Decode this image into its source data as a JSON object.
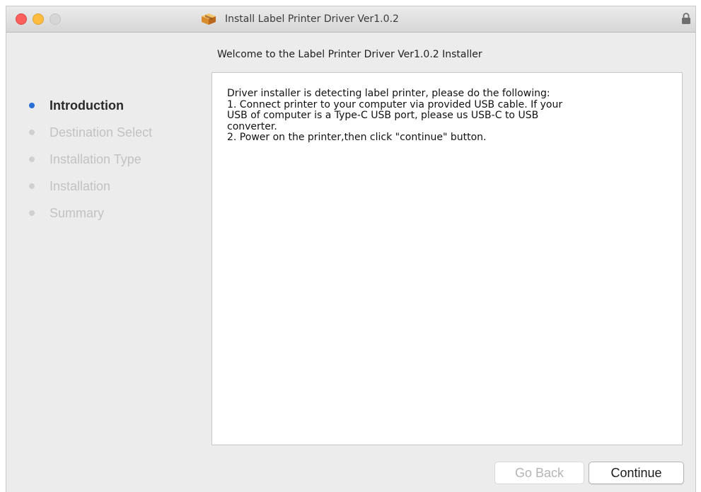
{
  "window": {
    "title": "Install Label Printer Driver Ver1.0.2",
    "icons": {
      "app": "package-icon",
      "lock": "lock-icon"
    }
  },
  "header": {
    "heading": "Welcome to the Label Printer Driver Ver1.0.2 Installer"
  },
  "sidebar": {
    "steps": [
      {
        "label": "Introduction",
        "active": true
      },
      {
        "label": "Destination Select",
        "active": false
      },
      {
        "label": "Installation Type",
        "active": false
      },
      {
        "label": "Installation",
        "active": false
      },
      {
        "label": "Summary",
        "active": false
      }
    ]
  },
  "content": {
    "lines": [
      "Driver installer is detecting label printer, please do the following:",
      "1. Connect printer to your computer via provided USB cable. If your",
      "USB of computer is a Type-C USB port, please us USB-C to USB",
      "converter.",
      "2. Power on the printer,then click \"continue\" button."
    ]
  },
  "buttons": {
    "go_back": "Go Back",
    "continue": "Continue"
  },
  "colors": {
    "window_bg": "#ececec",
    "active_step_dot": "#2a6fd6",
    "close_light": "#fc605c",
    "minimize_light": "#fdbc40",
    "zoom_light_disabled": "#d6d6d6"
  }
}
